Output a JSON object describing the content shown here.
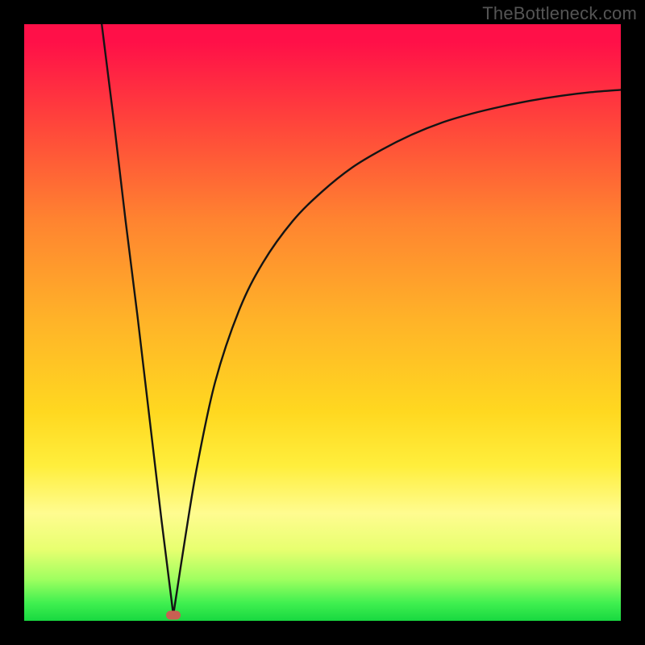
{
  "watermark": "TheBottleneck.com",
  "colors": {
    "frame_border": "#000000",
    "curve_stroke": "#141414",
    "marker_fill": "#c86052"
  },
  "chart_data": {
    "type": "line",
    "title": "",
    "xlabel": "",
    "ylabel": "",
    "xlim": [
      0,
      100
    ],
    "ylim": [
      0,
      100
    ],
    "grid": false,
    "legend": false,
    "annotations": [
      {
        "name": "vertex-marker",
        "x": 25,
        "y": 1
      }
    ],
    "series": [
      {
        "name": "bottleneck-curve",
        "x": [
          13,
          15,
          17,
          19,
          21,
          23,
          25,
          27,
          29,
          32,
          36,
          40,
          45,
          50,
          55,
          60,
          65,
          70,
          75,
          80,
          85,
          90,
          95,
          100
        ],
        "y": [
          100,
          84,
          67,
          51,
          34,
          17,
          1,
          14,
          26,
          40,
          52,
          60,
          67,
          72,
          76,
          79,
          81.5,
          83.5,
          85,
          86.2,
          87.2,
          88,
          88.6,
          89
        ]
      }
    ]
  }
}
